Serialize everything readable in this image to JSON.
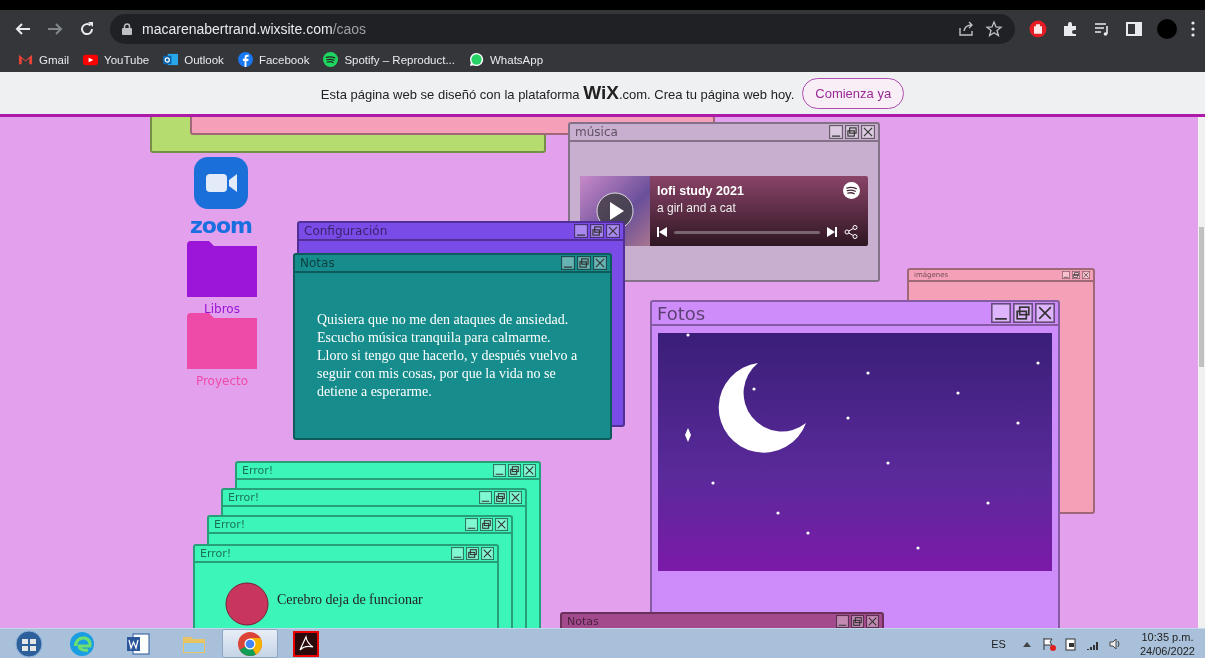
{
  "browser": {
    "url_host": "macarenabertrand.wixsite.com",
    "url_path": "/caos",
    "bookmarks": [
      {
        "kind": "gmail",
        "label": "Gmail"
      },
      {
        "kind": "youtube",
        "label": "YouTube"
      },
      {
        "kind": "outlook",
        "label": "Outlook"
      },
      {
        "kind": "facebook",
        "label": "Facebook"
      },
      {
        "kind": "spotify",
        "label": "Spotify – Reproduct..."
      },
      {
        "kind": "whatsapp",
        "label": "WhatsApp"
      }
    ]
  },
  "wix_banner": {
    "text": "Esta página web se diseñó con la plataforma **WiX**.com. Crea tu página web hoy.",
    "button": "Comienza ya"
  },
  "desktop": {
    "icons": [
      {
        "kind": "zoom",
        "label": "zoom"
      },
      {
        "kind": "folder",
        "label": "Libros",
        "color": "#9b16d8"
      },
      {
        "kind": "folder",
        "label": "Proyecto",
        "color": "#ee4aa8"
      }
    ],
    "windows": [
      {
        "kind": "blank",
        "color": "#b5dc6e"
      },
      {
        "kind": "blank",
        "color": "#f59fb9"
      },
      {
        "kind": "plain",
        "title": "Configuración",
        "color": "#7b4be8"
      },
      {
        "kind": "notes",
        "title": "Notas",
        "color": "#178c8c",
        "text": "Quisiera que no me den ataques de ansiedad. Escucho música tranquila para calmarme. Lloro si tengo que hacerlo, y después vuelvo a seguir con mis cosas, por que la vida no se detiene a esperarme."
      },
      {
        "kind": "music",
        "title": "música",
        "color": "#c8aecf",
        "track": "lofi study 2021",
        "artist": "a girl and a cat"
      },
      {
        "kind": "plain",
        "title": "imágenes",
        "color": "#f4a0b6"
      },
      {
        "kind": "photos",
        "title": "Fotos",
        "color": "#cd8cfa"
      },
      {
        "kind": "plain",
        "title": "Error!",
        "color": "#3cf5b9"
      },
      {
        "kind": "plain",
        "title": "Error!",
        "color": "#3cf5b9"
      },
      {
        "kind": "plain",
        "title": "Error!",
        "color": "#3cf5b9"
      },
      {
        "kind": "error",
        "title": "Error!",
        "color": "#3cf5b9",
        "message": "Cerebro deja de funcionar"
      },
      {
        "kind": "plain",
        "title": "Notas",
        "color": "#a34a8c"
      }
    ]
  },
  "taskbar": {
    "apps": [
      {
        "kind": "edge",
        "selected": false
      },
      {
        "kind": "word",
        "selected": false
      },
      {
        "kind": "explorer",
        "selected": false
      },
      {
        "kind": "chrome",
        "selected": true
      },
      {
        "kind": "acrobat",
        "selected": false
      }
    ],
    "language": "ES",
    "time": "10:35 p.m.",
    "date": "24/06/2022"
  }
}
